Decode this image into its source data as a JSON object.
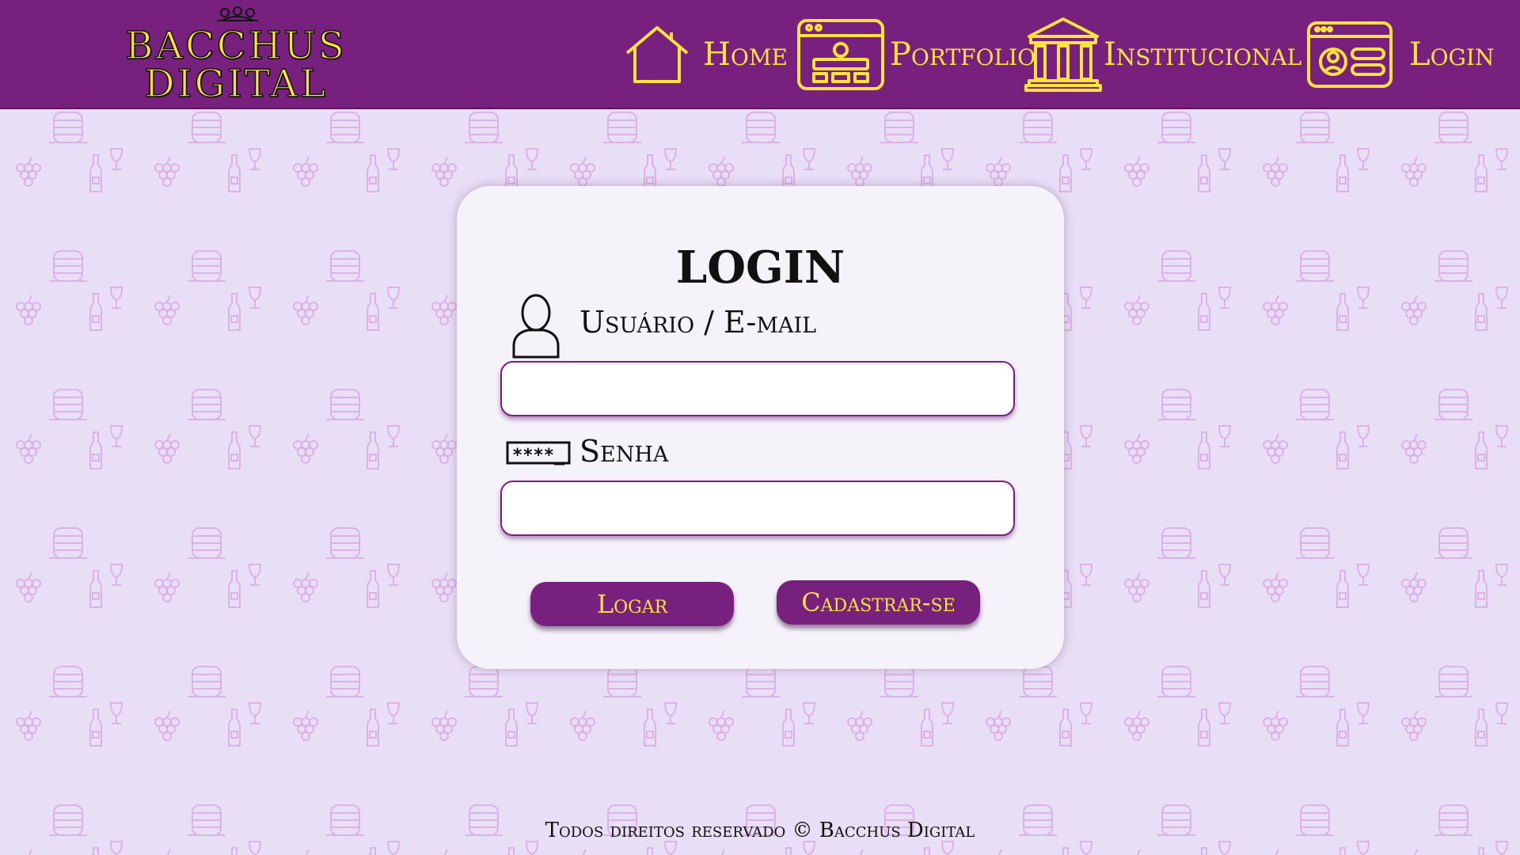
{
  "brand": {
    "line1": "BACCHUS",
    "line2": "DIGITAL",
    "icon": "grapes-crest-icon",
    "colors": {
      "header_bg": "#78207e",
      "accent": "#ffe23f",
      "page_bg": "#e8def5"
    }
  },
  "nav": {
    "items": [
      {
        "label": "Home",
        "icon": "house-icon"
      },
      {
        "label": "Portfolio",
        "icon": "browser-window-icon"
      },
      {
        "label": "Institucional",
        "icon": "building-columns-icon"
      },
      {
        "label": "Login",
        "icon": "profile-card-icon"
      }
    ]
  },
  "login": {
    "title": "LOGIN",
    "user_label": "Usuário / E-mail",
    "user_icon": "user-icon",
    "user_value": "",
    "password_label": "Senha",
    "password_icon": "password-field-icon",
    "password_icon_text": "****_",
    "password_value": "",
    "login_button": "Logar",
    "register_button": "Cadastrar-se"
  },
  "footer": {
    "text": "Todos direitos reservado © Bacchus Digital"
  },
  "background": {
    "pattern_icons": [
      "barrel-icon",
      "wine-glass-icon",
      "grapes-icon",
      "wine-bottle-icon"
    ]
  }
}
